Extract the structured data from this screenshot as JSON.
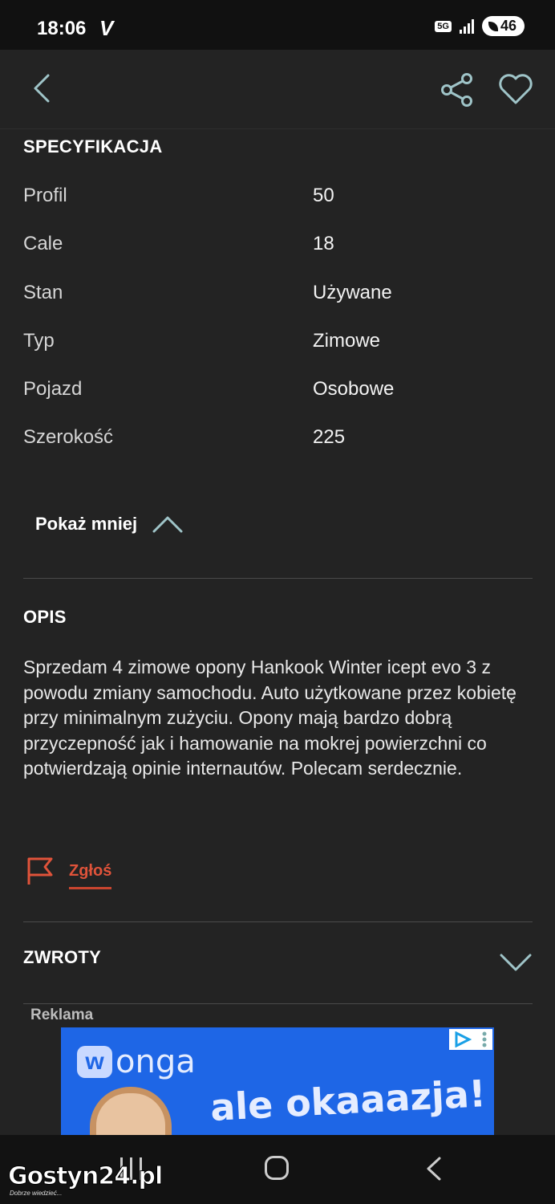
{
  "status": {
    "time": "18:06",
    "carrier_icon": "V",
    "network": "5G",
    "battery": "46"
  },
  "topbar": {
    "back": "back-arrow",
    "share": "share-icon",
    "favorite": "heart-icon"
  },
  "specs": {
    "title": "SPECYFIKACJA",
    "rows": [
      {
        "label": "Profil",
        "value": "50"
      },
      {
        "label": "Cale",
        "value": "18"
      },
      {
        "label": "Stan",
        "value": "Używane"
      },
      {
        "label": "Typ",
        "value": "Zimowe"
      },
      {
        "label": "Pojazd",
        "value": "Osobowe"
      },
      {
        "label": "Szerokość",
        "value": "225"
      }
    ],
    "toggle_label": "Pokaż mniej"
  },
  "description": {
    "title": "OPIS",
    "text": "Sprzedam 4 zimowe opony Hankook Winter icept evo 3 z powodu zmiany samochodu. Auto użytkowane przez kobietę przy minimalnym zużyciu. Opony mają bardzo dobrą przyczepność jak i hamowanie na mokrej powierzchni co potwierdzają opinie internautów. Polecam serdecznie."
  },
  "report": {
    "label": "Zgłoś"
  },
  "returns": {
    "title": "ZWROTY"
  },
  "ad": {
    "label": "Reklama",
    "brand": "onga",
    "brand_initial": "w",
    "headline": "ale okaaazja!"
  },
  "watermark": {
    "site": "Gostyn24.pl",
    "tagline": "Dobrze wiedzieć..."
  },
  "colors": {
    "background": "#232323",
    "accent_red": "#e0533a",
    "icon_teal": "#9fc4c8"
  }
}
